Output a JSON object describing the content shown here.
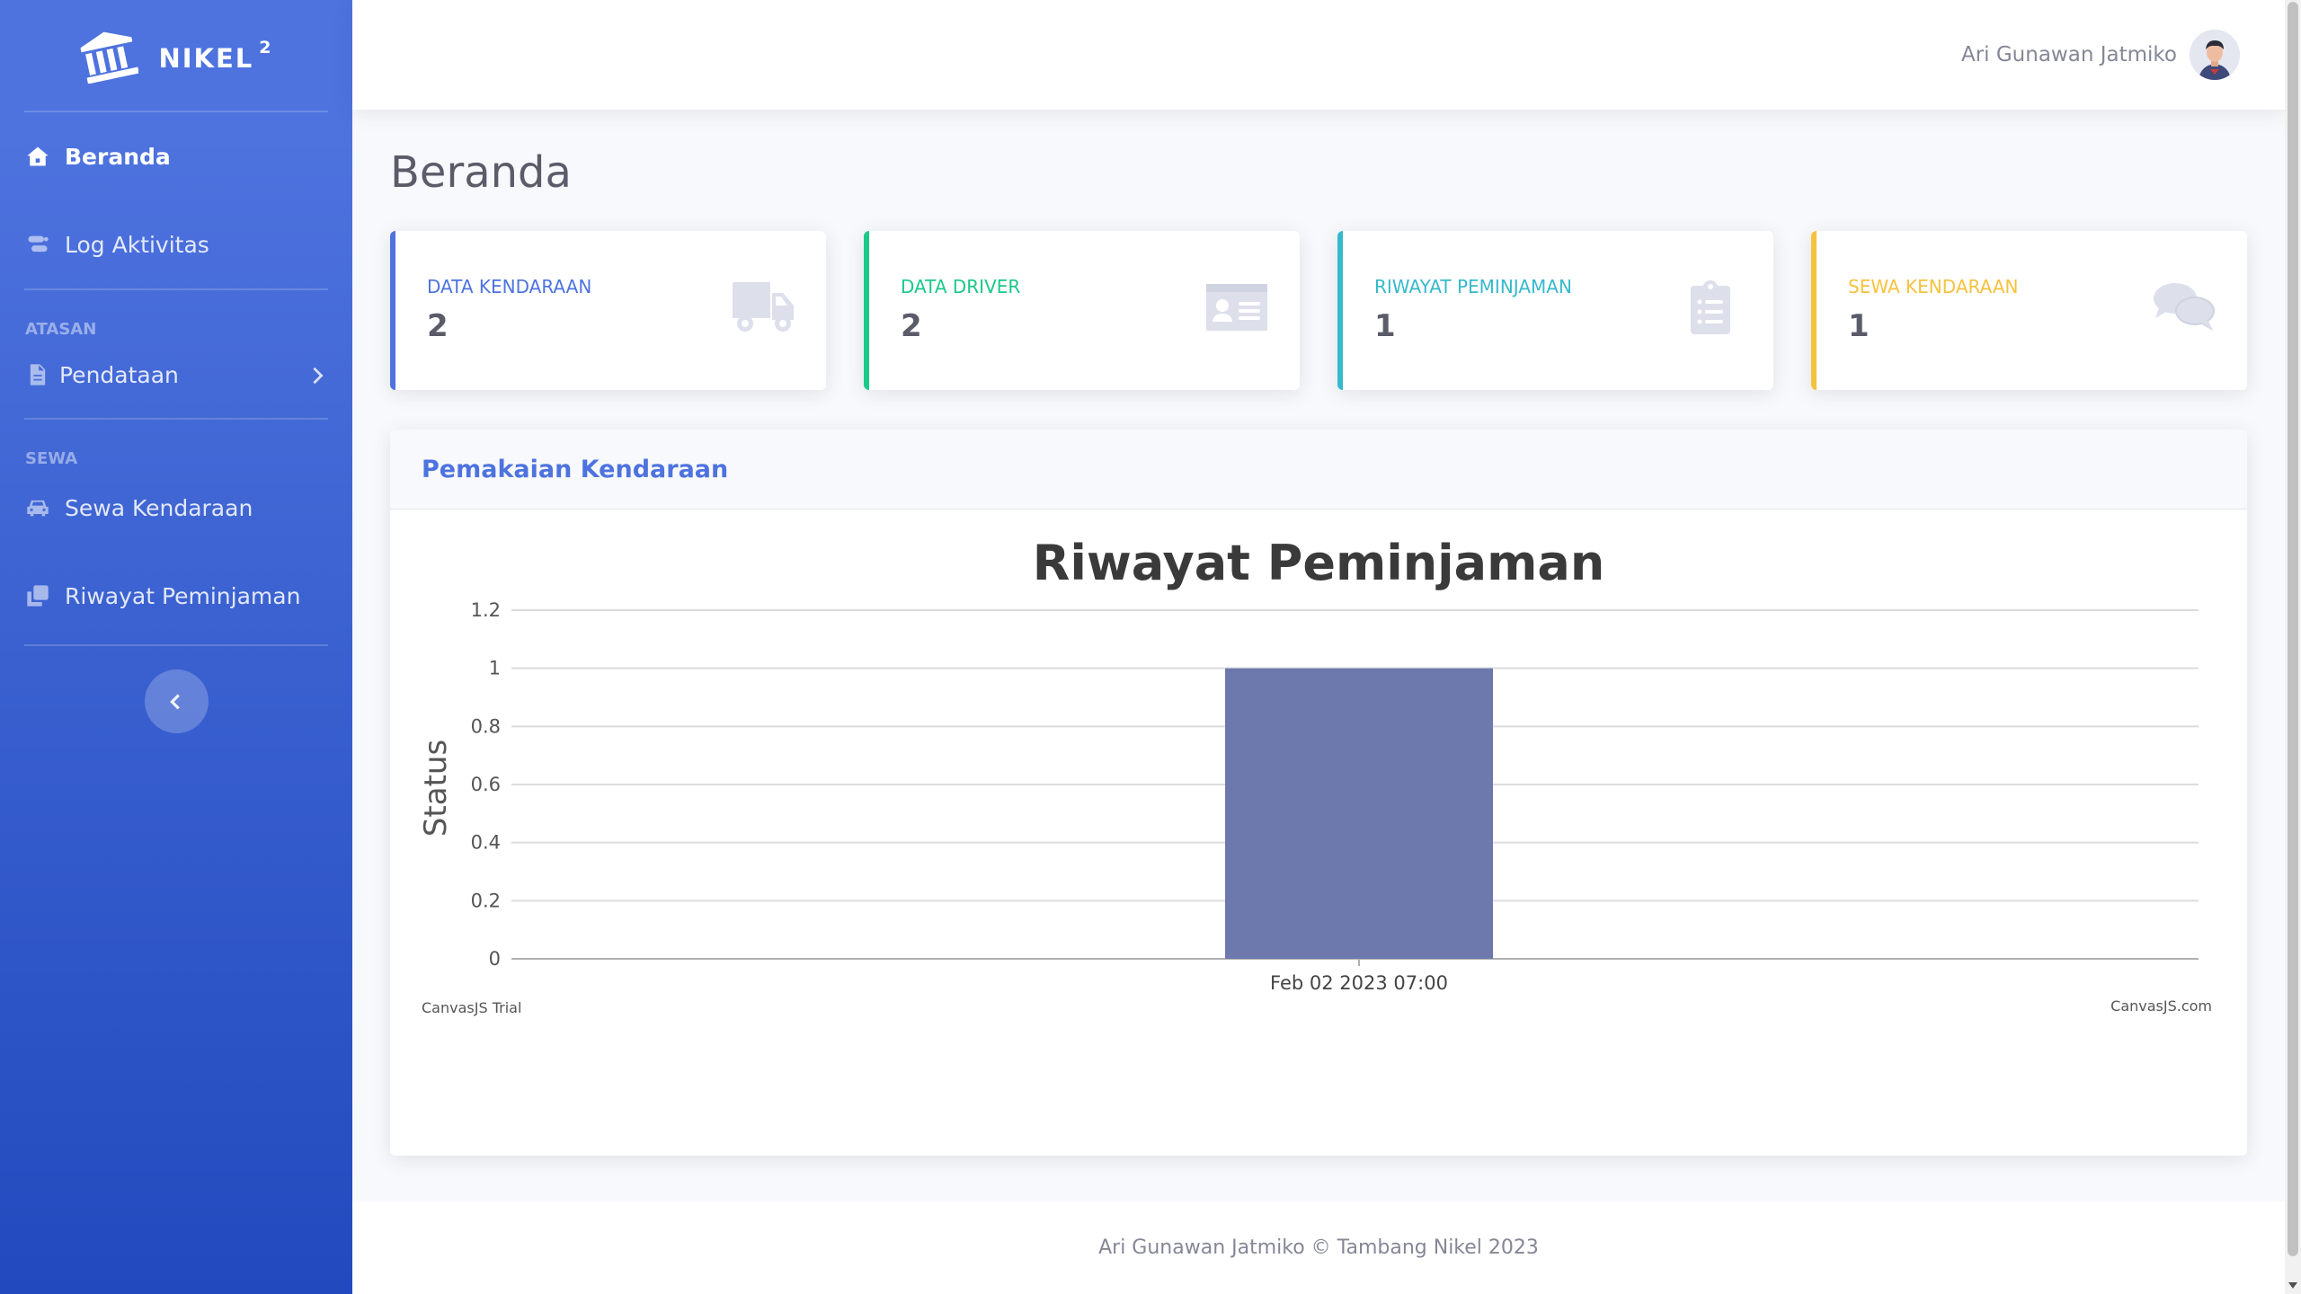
{
  "brand": {
    "name": "NIKEL",
    "superscript": "2"
  },
  "sidebar": {
    "items_top": [
      {
        "label": "Beranda",
        "icon": "home-icon",
        "active": true
      },
      {
        "label": "Log Aktivitas",
        "icon": "log-icon",
        "active": false
      }
    ],
    "heading_atasan": "ATASAN",
    "pendataan": {
      "label": "Pendataan",
      "icon": "file-icon"
    },
    "heading_sewa": "SEWA",
    "items_sewa": [
      {
        "label": "Sewa Kendaraan",
        "icon": "car-icon"
      },
      {
        "label": "Riwayat Peminjaman",
        "icon": "copy-icon"
      }
    ]
  },
  "topbar": {
    "user_name": "Ari Gunawan Jatmiko"
  },
  "page": {
    "title": "Beranda"
  },
  "cards": [
    {
      "label": "DATA KENDARAAN",
      "value": "2",
      "color": "#4e73df",
      "icon": "truck-icon"
    },
    {
      "label": "DATA DRIVER",
      "value": "2",
      "color": "#1cc88a",
      "icon": "id-card-icon"
    },
    {
      "label": "RIWAYAT PEMINJAMAN",
      "value": "1",
      "color": "#36b9cc",
      "icon": "clipboard-list-icon"
    },
    {
      "label": "SEWA KENDARAAN",
      "value": "1",
      "color": "#f6c23e",
      "icon": "comments-icon"
    }
  ],
  "chart_card": {
    "title": "Pemakaian Kendaraan"
  },
  "chart_data": {
    "type": "bar",
    "title": "Riwayat Peminjaman",
    "ylabel": "Status",
    "xlabel": "",
    "categories": [
      "Feb 02 2023 07:00"
    ],
    "values": [
      1
    ],
    "ylim": [
      0,
      1.2
    ],
    "yticks": [
      "0",
      "0.2",
      "0.4",
      "0.6",
      "0.8",
      "1",
      "1.2"
    ],
    "bar_color": "#6d79ad",
    "grid": true,
    "watermark_left": "CanvasJS Trial",
    "watermark_right": "CanvasJS.com"
  },
  "footer": {
    "text": "Ari Gunawan Jatmiko © Tambang Nikel 2023"
  }
}
